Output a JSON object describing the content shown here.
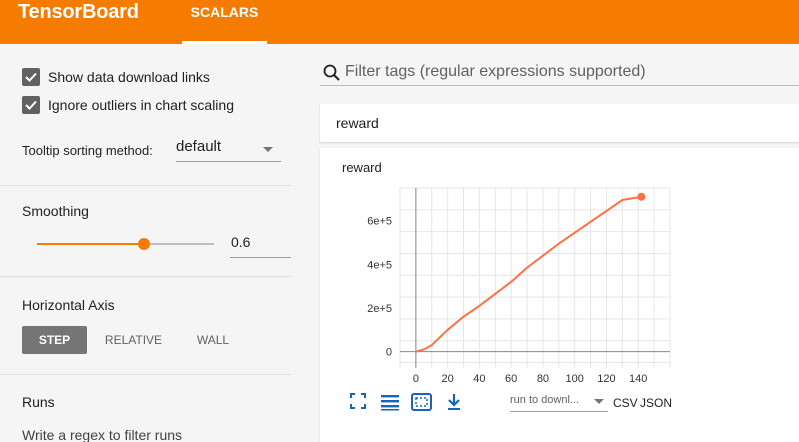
{
  "header": {
    "brand": "TensorBoard",
    "tab_label": "SCALARS",
    "color": "#f57c00"
  },
  "sidebar": {
    "show_download_links": {
      "label": "Show data download links",
      "checked": true
    },
    "ignore_outliers": {
      "label": "Ignore outliers in chart scaling",
      "checked": true
    },
    "tooltip_sorting": {
      "label": "Tooltip sorting method:",
      "value": "default"
    },
    "smoothing": {
      "title": "Smoothing",
      "value": "0.6",
      "fraction": 0.6
    },
    "horizontal_axis": {
      "title": "Horizontal Axis",
      "options": [
        "STEP",
        "RELATIVE",
        "WALL"
      ],
      "selected": "STEP"
    },
    "runs": {
      "title": "Runs",
      "filter_placeholder": "Write a regex to filter runs"
    }
  },
  "main": {
    "search_placeholder": "Filter tags (regular expressions supported)",
    "group_title": "reward",
    "card_title": "reward",
    "run_select": "run to downl...",
    "download_csv": "CSV",
    "download_json": "JSON"
  },
  "chart_data": {
    "type": "line",
    "title": "reward",
    "xlabel": "",
    "ylabel": "",
    "x_ticks": [
      0,
      20,
      40,
      60,
      80,
      100,
      120,
      140
    ],
    "y_ticks": [
      "0",
      "2e+5",
      "4e+5",
      "6e+5"
    ],
    "xlim": [
      -10,
      160
    ],
    "ylim": [
      -75000,
      750000
    ],
    "grid": true,
    "series": [
      {
        "color": "#ff7043",
        "x": [
          0,
          5,
          10,
          20,
          30,
          40,
          50,
          60,
          70,
          80,
          90,
          100,
          110,
          120,
          130,
          142
        ],
        "y": [
          0,
          10000,
          30000,
          100000,
          160000,
          210000,
          265000,
          320000,
          385000,
          440000,
          495000,
          545000,
          595000,
          645000,
          695000,
          710000
        ]
      }
    ]
  }
}
